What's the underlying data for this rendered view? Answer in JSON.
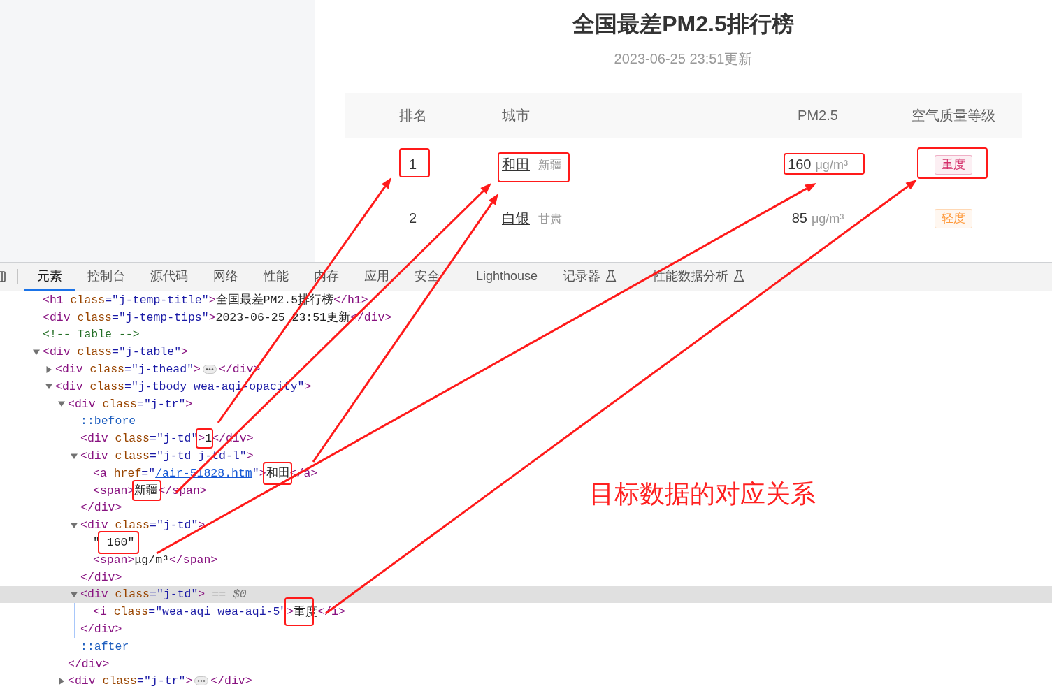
{
  "page": {
    "title": "全国最差PM2.5排行榜",
    "updated": "2023-06-25 23:51更新",
    "table": {
      "columns": [
        "排名",
        "城市",
        "PM2.5",
        "空气质量等级"
      ],
      "rows": [
        {
          "rank": "1",
          "city": "和田",
          "province": "新疆",
          "pm25": "160",
          "unit": "μg/m³",
          "aqi": "重度",
          "color": "#d4306a"
        },
        {
          "rank": "2",
          "city": "白银",
          "province": "甘肃",
          "pm25": "85",
          "unit": "μg/m³",
          "aqi": "轻度",
          "color": "#ff9a3c"
        }
      ]
    }
  },
  "devtools": {
    "tabs": [
      {
        "label": "元素",
        "selected": true,
        "experimental": false
      },
      {
        "label": "控制台",
        "selected": false,
        "experimental": false
      },
      {
        "label": "源代码",
        "selected": false,
        "experimental": false
      },
      {
        "label": "网络",
        "selected": false,
        "experimental": false
      },
      {
        "label": "性能",
        "selected": false,
        "experimental": false
      },
      {
        "label": "内存",
        "selected": false,
        "experimental": false
      },
      {
        "label": "应用",
        "selected": false,
        "experimental": false
      },
      {
        "label": "安全",
        "selected": false,
        "experimental": false
      },
      {
        "label": "Lighthouse",
        "selected": false,
        "experimental": false
      },
      {
        "label": "记录器",
        "selected": false,
        "experimental": true
      },
      {
        "label": "性能数据分析",
        "selected": false,
        "experimental": true
      }
    ],
    "selection_marker": "== $0",
    "tree": [
      {
        "selected": false,
        "tokens": [
          {
            "kind": "tag",
            "text": "<h1"
          },
          {
            "kind": "attr",
            "text": " class"
          },
          {
            "kind": "value",
            "text": "=\"j-temp-title\""
          },
          {
            "kind": "tag",
            "text": ">"
          },
          {
            "kind": "text",
            "text": "全国最差PM2.5排行榜"
          },
          {
            "kind": "tag",
            "text": "</h1>"
          }
        ]
      },
      {
        "selected": false,
        "tokens": [
          {
            "kind": "tag",
            "text": "<div"
          },
          {
            "kind": "attr",
            "text": " class"
          },
          {
            "kind": "value",
            "text": "=\"j-temp-tips\""
          },
          {
            "kind": "tag",
            "text": ">"
          },
          {
            "kind": "text",
            "text": "2023-06-25 23:51更新"
          },
          {
            "kind": "tag",
            "text": "</div>"
          }
        ]
      },
      {
        "selected": false,
        "tokens": [
          {
            "kind": "comment",
            "text": "<!-- Table -->"
          }
        ]
      },
      {
        "selected": false,
        "expanded": true,
        "tokens": [
          {
            "kind": "tag",
            "text": "<div"
          },
          {
            "kind": "attr",
            "text": " class"
          },
          {
            "kind": "value",
            "text": "=\"j-table\""
          },
          {
            "kind": "tag",
            "text": ">"
          }
        ],
        "children": [
          {
            "selected": false,
            "expanded": false,
            "tokens": [
              {
                "kind": "tag",
                "text": "<div"
              },
              {
                "kind": "attr",
                "text": " class"
              },
              {
                "kind": "value",
                "text": "=\"j-thead\""
              },
              {
                "kind": "tag",
                "text": ">"
              }
            ],
            "close": [
              {
                "kind": "tag",
                "text": "</div>"
              }
            ]
          },
          {
            "selected": false,
            "expanded": true,
            "tokens": [
              {
                "kind": "tag",
                "text": "<div"
              },
              {
                "kind": "attr",
                "text": " class"
              },
              {
                "kind": "value",
                "text": "=\"j-tbody wea-aqi-opacity\""
              },
              {
                "kind": "tag",
                "text": ">"
              }
            ],
            "children": [
              {
                "selected": false,
                "expanded": true,
                "tokens": [
                  {
                    "kind": "tag",
                    "text": "<div"
                  },
                  {
                    "kind": "attr",
                    "text": " class"
                  },
                  {
                    "kind": "value",
                    "text": "=\"j-tr\""
                  },
                  {
                    "kind": "tag",
                    "text": ">"
                  }
                ],
                "children": [
                  {
                    "selected": false,
                    "tokens": [
                      {
                        "kind": "pseudo",
                        "text": "::before"
                      }
                    ]
                  },
                  {
                    "selected": false,
                    "tokens": [
                      {
                        "kind": "tag",
                        "text": "<div"
                      },
                      {
                        "kind": "attr",
                        "text": " class"
                      },
                      {
                        "kind": "value",
                        "text": "=\"j-td\""
                      },
                      {
                        "kind": "tag",
                        "text": ">"
                      },
                      {
                        "kind": "text",
                        "text": "1"
                      },
                      {
                        "kind": "tag",
                        "text": "</div>"
                      }
                    ]
                  },
                  {
                    "selected": false,
                    "expanded": true,
                    "tokens": [
                      {
                        "kind": "tag",
                        "text": "<div"
                      },
                      {
                        "kind": "attr",
                        "text": " class"
                      },
                      {
                        "kind": "value",
                        "text": "=\"j-td j-td-l\""
                      },
                      {
                        "kind": "tag",
                        "text": ">"
                      }
                    ],
                    "children": [
                      {
                        "selected": false,
                        "tokens": [
                          {
                            "kind": "tag",
                            "text": "<a"
                          },
                          {
                            "kind": "attr",
                            "text": " href"
                          },
                          {
                            "kind": "value",
                            "text": "=\""
                          },
                          {
                            "kind": "link",
                            "text": "/air-51828.htm"
                          },
                          {
                            "kind": "value",
                            "text": "\""
                          },
                          {
                            "kind": "tag",
                            "text": ">"
                          },
                          {
                            "kind": "text",
                            "text": "和田"
                          },
                          {
                            "kind": "tag",
                            "text": "</a>"
                          }
                        ]
                      },
                      {
                        "selected": false,
                        "tokens": [
                          {
                            "kind": "tag",
                            "text": "<span>"
                          },
                          {
                            "kind": "text",
                            "text": "新疆"
                          },
                          {
                            "kind": "tag",
                            "text": "</span>"
                          }
                        ]
                      }
                    ],
                    "close": [
                      {
                        "kind": "tag",
                        "text": "</div>"
                      }
                    ]
                  },
                  {
                    "selected": false,
                    "expanded": true,
                    "tokens": [
                      {
                        "kind": "tag",
                        "text": "<div"
                      },
                      {
                        "kind": "attr",
                        "text": " class"
                      },
                      {
                        "kind": "value",
                        "text": "=\"j-td\""
                      },
                      {
                        "kind": "tag",
                        "text": ">"
                      }
                    ],
                    "children": [
                      {
                        "selected": false,
                        "tokens": [
                          {
                            "kind": "text",
                            "text": "\" 160\""
                          }
                        ]
                      },
                      {
                        "selected": false,
                        "tokens": [
                          {
                            "kind": "tag",
                            "text": "<span>"
                          },
                          {
                            "kind": "text",
                            "text": "μg/m³"
                          },
                          {
                            "kind": "tag",
                            "text": "</span>"
                          }
                        ]
                      }
                    ],
                    "close": [
                      {
                        "kind": "tag",
                        "text": "</div>"
                      }
                    ]
                  },
                  {
                    "selected": true,
                    "expanded": true,
                    "tokens": [
                      {
                        "kind": "tag",
                        "text": "<div"
                      },
                      {
                        "kind": "attr",
                        "text": " class"
                      },
                      {
                        "kind": "value",
                        "text": "=\"j-td\""
                      },
                      {
                        "kind": "tag",
                        "text": ">"
                      }
                    ],
                    "children": [
                      {
                        "selected": false,
                        "tokens": [
                          {
                            "kind": "tag",
                            "text": "<i"
                          },
                          {
                            "kind": "attr",
                            "text": " class"
                          },
                          {
                            "kind": "value",
                            "text": "=\"wea-aqi wea-aqi-5\""
                          },
                          {
                            "kind": "tag",
                            "text": ">"
                          },
                          {
                            "kind": "text",
                            "text": "重度"
                          },
                          {
                            "kind": "tag",
                            "text": "</i>"
                          }
                        ]
                      }
                    ],
                    "close": [
                      {
                        "kind": "tag",
                        "text": "</div>"
                      }
                    ]
                  },
                  {
                    "selected": false,
                    "tokens": [
                      {
                        "kind": "pseudo",
                        "text": "::after"
                      }
                    ]
                  }
                ],
                "close": [
                  {
                    "kind": "tag",
                    "text": "</div>"
                  }
                ]
              },
              {
                "selected": false,
                "expanded": false,
                "tokens": [
                  {
                    "kind": "tag",
                    "text": "<div"
                  },
                  {
                    "kind": "attr",
                    "text": " class"
                  },
                  {
                    "kind": "value",
                    "text": "=\"j-tr\""
                  },
                  {
                    "kind": "tag",
                    "text": ">"
                  }
                ],
                "close": [
                  {
                    "kind": "tag",
                    "text": "</div>"
                  }
                ]
              }
            ]
          }
        ]
      }
    ]
  },
  "annotation": {
    "caption": "目标数据的对应关系"
  }
}
